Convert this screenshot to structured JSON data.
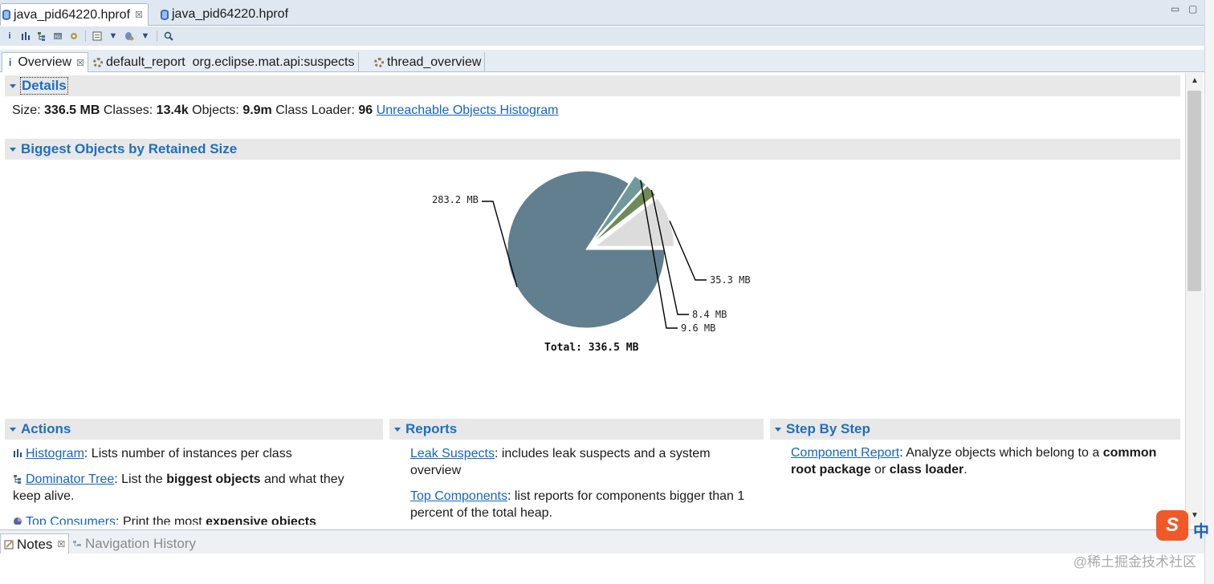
{
  "editor_tabs": [
    {
      "label": "java_pid64220.hprof",
      "active": true,
      "closable": true
    },
    {
      "label": "java_pid64220.hprof",
      "active": false,
      "closable": false
    }
  ],
  "editor_tab_close_glyph": "☒",
  "window_controls": {
    "minimize": "▭",
    "maximize": "▢"
  },
  "toolbar": {
    "icons": [
      "info-icon",
      "histogram-icon",
      "dominator-tree-icon",
      "oql-icon",
      "gear-icon",
      "report-icon",
      "dropdown-icon",
      "query-icon",
      "dropdown-icon",
      "search-icon"
    ],
    "info_glyph": "i",
    "dropdown_glyph": "▼"
  },
  "sub_tabs": [
    {
      "label": "Overview",
      "active": true,
      "icon": "info-icon",
      "icon_glyph": "i"
    },
    {
      "label": "default_report  org.eclipse.mat.api:suspects",
      "active": false,
      "icon": "gear-icon"
    },
    {
      "label": "thread_overview",
      "active": false,
      "icon": "gear-icon"
    }
  ],
  "sub_tab_close_glyph": "☒",
  "details": {
    "title": "Details",
    "size_label": "Size:",
    "size_value": "336.5 MB",
    "classes_label": "Classes:",
    "classes_value": "13.4k",
    "objects_label": "Objects:",
    "objects_value": "9.9m",
    "classloader_label": "Class Loader:",
    "classloader_value": "96",
    "histogram_link": "Unreachable Objects Histogram"
  },
  "biggest_objects": {
    "title": "Biggest Objects by Retained Size"
  },
  "chart_data": {
    "type": "pie",
    "unit": "MB",
    "slices": [
      {
        "label": "283.2 MB",
        "value": 283.2,
        "color": "#617f8f"
      },
      {
        "label": "35.3 MB",
        "value": 35.3,
        "color": "#dcdcdc"
      },
      {
        "label": "8.4 MB",
        "value": 8.4,
        "color": "#6f8a56"
      },
      {
        "label": "9.6 MB",
        "value": 9.6,
        "color": "#6f9a99"
      }
    ],
    "total_label": "Total: 336.5 MB",
    "total_value": 336.5
  },
  "actions": {
    "title": "Actions",
    "items": [
      {
        "link": "Histogram",
        "text_parts": [
          ": Lists number of instances per class"
        ],
        "icon": "histogram-icon"
      },
      {
        "link": "Dominator Tree",
        "text_parts": [
          ": List the ",
          "biggest objects",
          " and what they keep alive."
        ],
        "icon": "dominator-tree-icon"
      },
      {
        "link": "Top Consumers",
        "text_parts": [
          ": Print the most ",
          "expensive objects"
        ],
        "icon": "top-consumers-icon"
      }
    ]
  },
  "reports": {
    "title": "Reports",
    "items": [
      {
        "link": "Leak Suspects",
        "text": ": includes leak suspects and a system overview"
      },
      {
        "link": "Top Components",
        "text": ": list reports for components bigger than 1 percent of the total heap."
      }
    ]
  },
  "step_by_step": {
    "title": "Step By Step",
    "items": [
      {
        "link": "Component Report",
        "text_parts": [
          ": Analyze objects which belong to a ",
          "common root package",
          " or ",
          "class loader",
          "."
        ]
      }
    ]
  },
  "bottom_tabs": [
    {
      "label": "Notes",
      "active": true,
      "icon": "notes-icon",
      "closable": true
    },
    {
      "label": "Navigation History",
      "active": false,
      "icon": "navigation-history-icon"
    }
  ],
  "scrollbar": {
    "up": "▲",
    "down": "▼"
  },
  "watermark": "@稀土掘金技术社区",
  "ime": {
    "logo": "S",
    "mode": "中"
  }
}
